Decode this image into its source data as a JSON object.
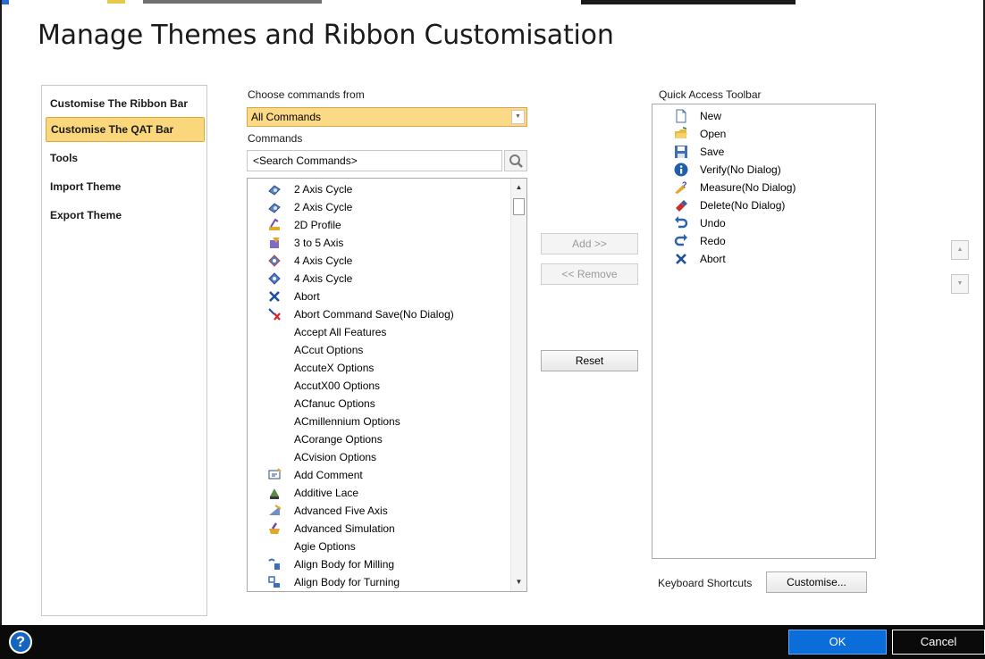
{
  "dialog": {
    "title": "Manage Themes and Ribbon Customisation",
    "nav": [
      {
        "label": "Customise The Ribbon Bar",
        "active": false
      },
      {
        "label": "Customise The QAT Bar",
        "active": true
      },
      {
        "label": "Tools",
        "active": false
      },
      {
        "label": "Import Theme",
        "active": false
      },
      {
        "label": "Export Theme",
        "active": false
      }
    ]
  },
  "commands": {
    "choose_label": "Choose commands from",
    "choose_value": "All Commands",
    "commands_label": "Commands",
    "search_value": "<Search Commands>",
    "items": [
      {
        "label": "2 Axis Cycle",
        "icon": "axis-cycle-icon"
      },
      {
        "label": "2 Axis Cycle",
        "icon": "axis-cycle-icon"
      },
      {
        "label": "2D Profile",
        "icon": "profile-2d-icon"
      },
      {
        "label": "3 to 5 Axis",
        "icon": "axis-3to5-icon"
      },
      {
        "label": "4 Axis Cycle",
        "icon": "axis-cycle-4-icon"
      },
      {
        "label": "4 Axis Cycle",
        "icon": "axis-cycle-4-icon"
      },
      {
        "label": "Abort",
        "icon": "abort-x-icon"
      },
      {
        "label": "Abort Command Save(No Dialog)",
        "icon": "abort-save-icon"
      },
      {
        "label": "Accept All Features",
        "icon": ""
      },
      {
        "label": "ACcut Options",
        "icon": ""
      },
      {
        "label": "AccuteX Options",
        "icon": ""
      },
      {
        "label": "AccutX00 Options",
        "icon": ""
      },
      {
        "label": "ACfanuc Options",
        "icon": ""
      },
      {
        "label": "ACmillennium Options",
        "icon": ""
      },
      {
        "label": "ACorange Options",
        "icon": ""
      },
      {
        "label": "ACvision Options",
        "icon": ""
      },
      {
        "label": "Add Comment",
        "icon": "add-comment-icon"
      },
      {
        "label": "Additive Lace",
        "icon": "additive-lace-icon"
      },
      {
        "label": "Advanced Five Axis",
        "icon": "advanced-five-axis-icon"
      },
      {
        "label": "Advanced Simulation",
        "icon": "advanced-simulation-icon"
      },
      {
        "label": "Agie Options",
        "icon": ""
      },
      {
        "label": "Align Body for Milling",
        "icon": "align-milling-icon"
      },
      {
        "label": "Align Body for Turning",
        "icon": "align-turning-icon"
      }
    ]
  },
  "actions": {
    "add_label": "Add >>",
    "remove_label": "<< Remove",
    "reset_label": "Reset"
  },
  "qat": {
    "label": "Quick Access Toolbar",
    "items": [
      {
        "label": "New",
        "icon": "new-file-icon"
      },
      {
        "label": "Open",
        "icon": "open-folder-icon"
      },
      {
        "label": "Save",
        "icon": "save-disk-icon"
      },
      {
        "label": "Verify(No Dialog)",
        "icon": "info-verify-icon"
      },
      {
        "label": "Measure(No Dialog)",
        "icon": "measure-icon"
      },
      {
        "label": "Delete(No Dialog)",
        "icon": "delete-eraser-icon"
      },
      {
        "label": "Undo",
        "icon": "undo-arrow-icon"
      },
      {
        "label": "Redo",
        "icon": "redo-arrow-icon"
      },
      {
        "label": "Abort",
        "icon": "abort-x-icon"
      }
    ],
    "move_up": "▲",
    "move_down": "▼"
  },
  "shortcuts": {
    "label": "Keyboard Shortcuts",
    "button": "Customise..."
  },
  "footer": {
    "help": "?",
    "ok": "OK",
    "cancel": "Cancel"
  },
  "colors": {
    "accent_selected": "#f9d77a",
    "ok_button": "#0b6dd9",
    "footer_bg": "#0a0a0a"
  }
}
